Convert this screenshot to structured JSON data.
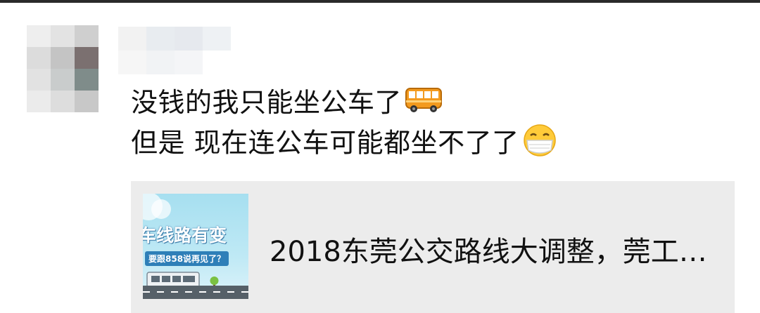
{
  "post": {
    "line1": "没钱的我只能坐公车了",
    "line2": "但是 现在连公车可能都坐不了了",
    "line1_emoji": "bus-emoji",
    "line2_emoji": "mask-face-emoji"
  },
  "link_card": {
    "title": "2018东莞公交路线大调整，莞工…",
    "thumbnail": {
      "headline": "车线路有变",
      "subtitle": "要跟858说再见了？"
    }
  },
  "colors": {
    "card_background": "#ececec",
    "text": "#111111",
    "thumb_sky": "#a6dff0",
    "thumb_pill": "#2e7fb8"
  }
}
